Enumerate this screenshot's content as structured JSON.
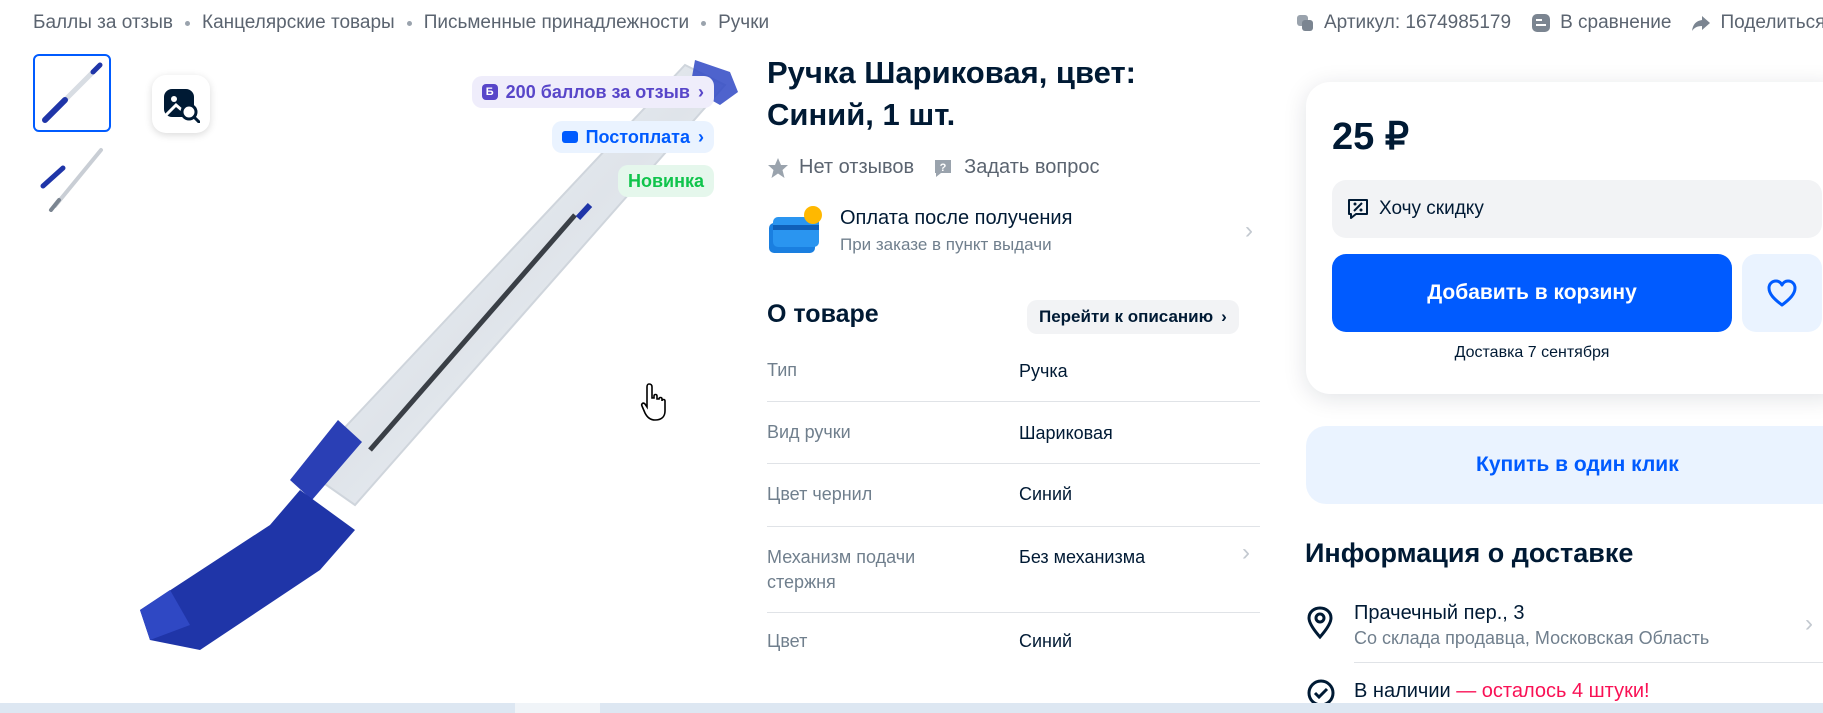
{
  "breadcrumbs": [
    "Баллы за отзыв",
    "Канцелярские товары",
    "Письменные принадлежности",
    "Ручки"
  ],
  "top_actions": {
    "article": "Артикул: 1674985179",
    "compare": "В сравнение",
    "share": "Поделиться"
  },
  "gallery": {
    "badges": {
      "points": "200 баллов за отзыв",
      "postpay": "Постоплата",
      "new": "Новинка"
    }
  },
  "product": {
    "title": "Ручка Шариковая, цвет: Синий, 1 шт.",
    "no_reviews": "Нет отзывов",
    "ask_question": "Задать вопрос",
    "payment": {
      "title": "Оплата после получения",
      "subtitle": "При заказе в пункт выдачи"
    },
    "about_title": "О товаре",
    "goto_description": "Перейти к описанию",
    "specs": [
      {
        "key": "Тип",
        "value": "Ручка"
      },
      {
        "key": "Вид ручки",
        "value": "Шариковая"
      },
      {
        "key": "Цвет чернил",
        "value": "Синий"
      },
      {
        "key": "Механизм подачи стержня",
        "value": "Без механизма"
      },
      {
        "key": "Цвет",
        "value": "Синий"
      }
    ]
  },
  "buy_card": {
    "price": "25 ₽",
    "want_discount": "Хочу скидку",
    "add_to_cart": "Добавить в корзину",
    "delivery_date": "Доставка 7 сентября",
    "buy_one_click": "Купить в один клик"
  },
  "delivery_info": {
    "title": "Информация о доставке",
    "address": "Прачечный пер., 3",
    "address_sub": "Со склада продавца, Московская Область",
    "stock_main": "В наличии",
    "stock_left": " — осталось 4 штуки!"
  },
  "colors": {
    "accent": "#005bff",
    "points": "#5846c9",
    "new": "#10c44c",
    "stock_red": "#f91155",
    "pen_blue": "#1f35a8"
  }
}
